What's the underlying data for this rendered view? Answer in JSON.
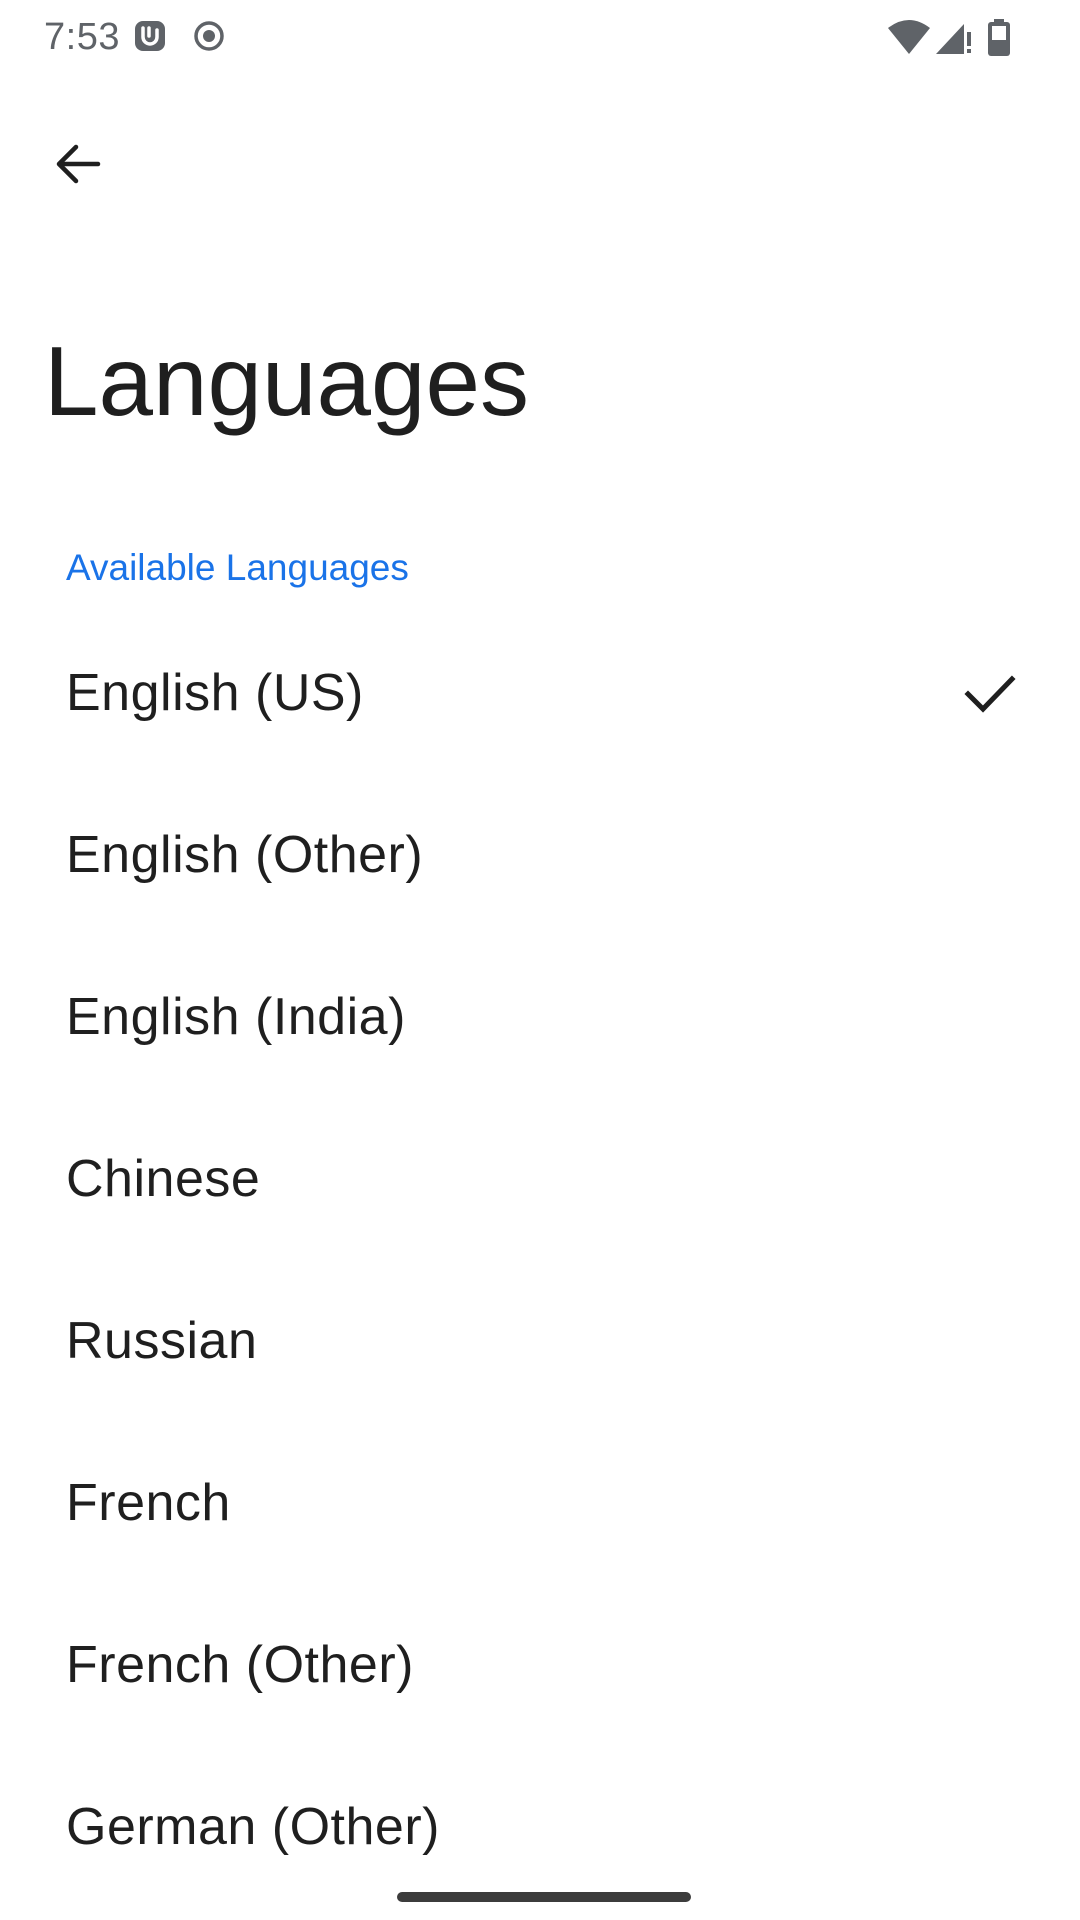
{
  "status_bar": {
    "time": "7:53",
    "left_icons": [
      "bump-notification-icon",
      "record-dot-icon"
    ],
    "right_icons": [
      "wifi-icon",
      "cell-signal-icon",
      "battery-icon"
    ]
  },
  "header": {
    "back_icon": "arrow-back-icon"
  },
  "page": {
    "title": "Languages"
  },
  "section": {
    "header": "Available Languages",
    "accent_color": "#1a73e8"
  },
  "languages": [
    {
      "label": "English (US)",
      "selected": true
    },
    {
      "label": "English (Other)",
      "selected": false
    },
    {
      "label": "English (India)",
      "selected": false
    },
    {
      "label": "Chinese",
      "selected": false
    },
    {
      "label": "Russian",
      "selected": false
    },
    {
      "label": "French",
      "selected": false
    },
    {
      "label": "French (Other)",
      "selected": false
    },
    {
      "label": "German (Other)",
      "selected": false
    }
  ]
}
